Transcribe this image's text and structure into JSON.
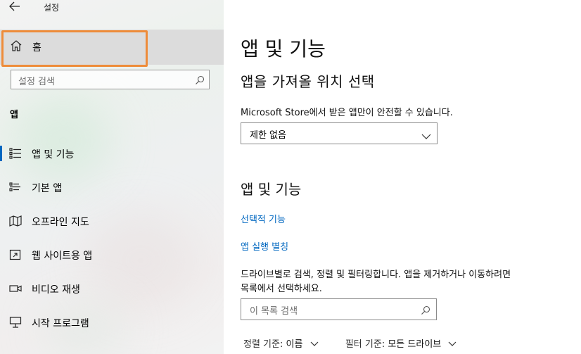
{
  "window": {
    "title": "설정",
    "back_icon": "back-arrow-icon"
  },
  "sidebar": {
    "home_label": "홈",
    "search_placeholder": "설정 검색",
    "section": "앱",
    "items": [
      {
        "label": "앱 및 기능",
        "icon": "apps-features-icon",
        "selected": true
      },
      {
        "label": "기본 앱",
        "icon": "default-apps-icon",
        "selected": false
      },
      {
        "label": "오프라인 지도",
        "icon": "offline-maps-icon",
        "selected": false
      },
      {
        "label": "웹 사이트용 앱",
        "icon": "apps-for-websites-icon",
        "selected": false
      },
      {
        "label": "비디오 재생",
        "icon": "video-playback-icon",
        "selected": false
      },
      {
        "label": "시작 프로그램",
        "icon": "startup-icon",
        "selected": false
      }
    ]
  },
  "main": {
    "title": "앱 및 기능",
    "install_section": {
      "heading": "앱을 가져올 위치 선택",
      "description": "Microsoft Store에서 받은 앱만이 안전할 수 있습니다.",
      "dropdown_value": "제한 없음"
    },
    "apps_section": {
      "heading": "앱 및 기능",
      "link_optional": "선택적 기능",
      "link_aliases": "앱 실행 별칭",
      "description_line1": "드라이브별로 검색, 정렬 및 필터링합니다. 앱을 제거하거나 이동하려면",
      "description_line2": "목록에서 선택하세요.",
      "search_placeholder": "이 목록 검색",
      "sort_label": "정렬 기준:",
      "sort_value": "이름",
      "filter_label": "필터 기준:",
      "filter_value": "모든 드라이브"
    }
  },
  "colors": {
    "accent": "#0067c0",
    "highlight": "#ee8c3a",
    "selected_bg": "#dcdcdc"
  }
}
